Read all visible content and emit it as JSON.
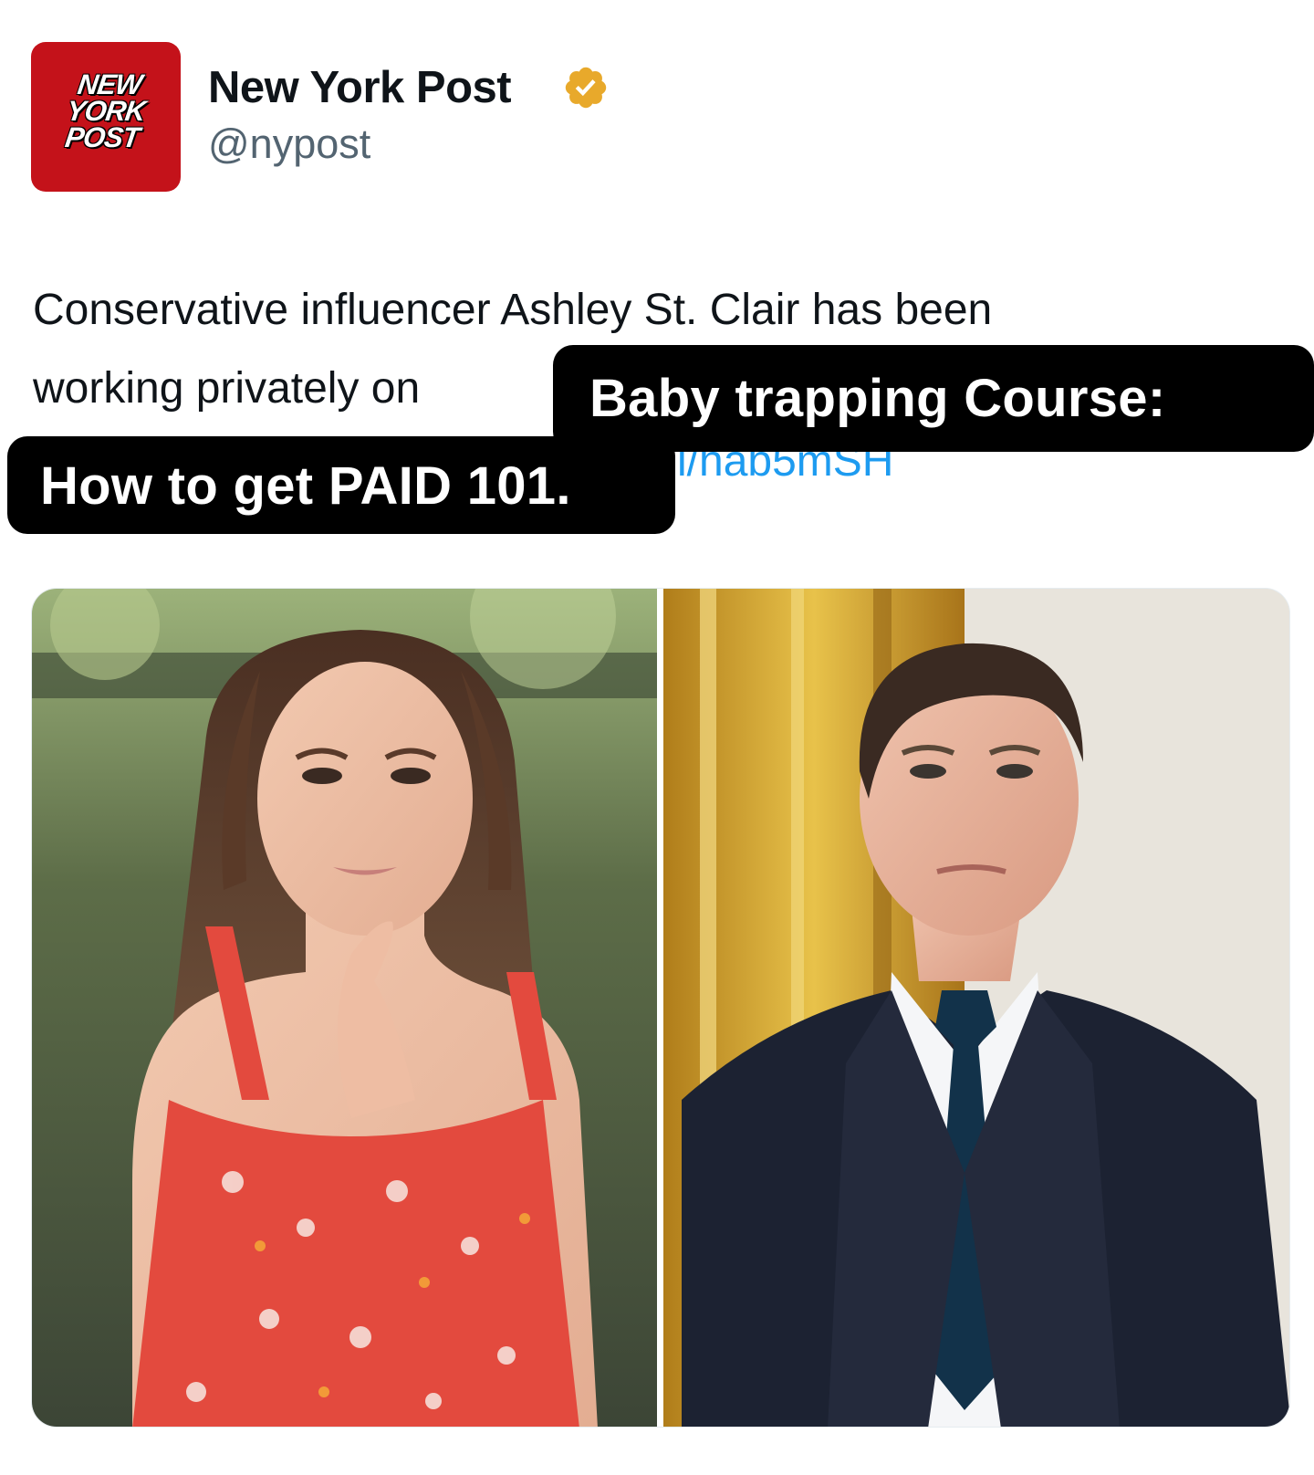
{
  "header": {
    "logo": {
      "name": "new-york-post-logo",
      "lines": [
        "NEW",
        "YORK",
        "POST"
      ],
      "bg_color": "#c4121a"
    },
    "account_name": "New York Post",
    "handle": "@nypost",
    "verified_icon": "verified-badge-icon",
    "verified_color": "#e8a92b"
  },
  "tweet": {
    "line1": "Conservative influencer Ashley St. Clair has been",
    "line2_start": "working privately on",
    "link_tail": "l/hab5mSH",
    "link_color": "#1d9bf0"
  },
  "overlay": {
    "line1": "Baby trapping Course:",
    "line2": "How to get PAID 101."
  },
  "media": {
    "images": [
      {
        "name": "photo-woman-red-floral-dress"
      },
      {
        "name": "photo-man-dark-suit"
      }
    ]
  }
}
